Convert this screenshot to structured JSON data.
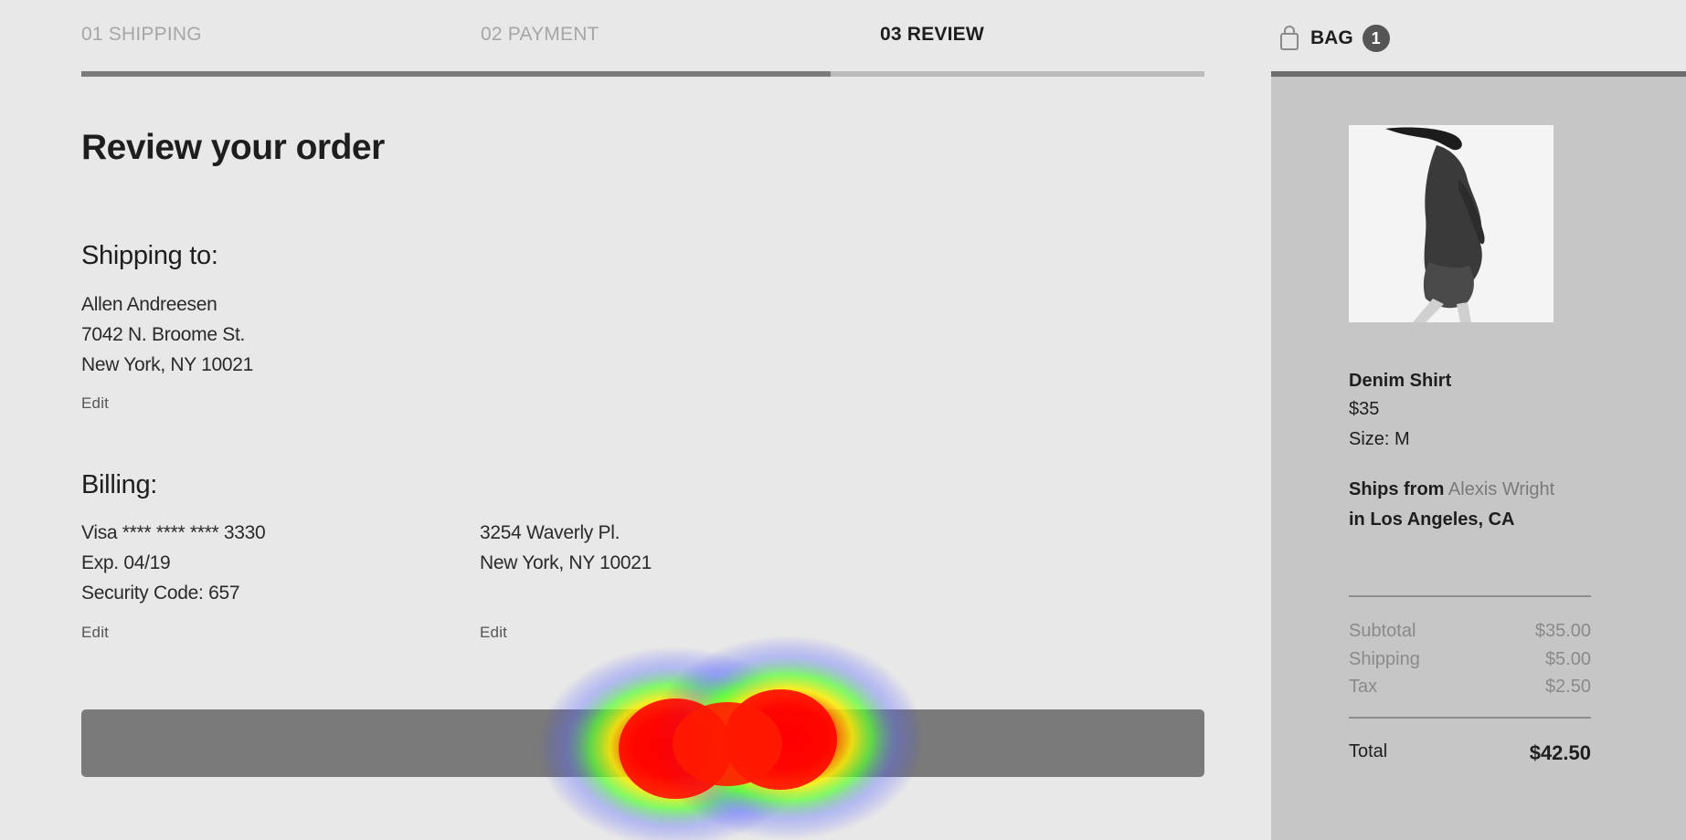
{
  "checkout": {
    "steps": [
      {
        "label": "01 SHIPPING"
      },
      {
        "label": "02 PAYMENT"
      },
      {
        "label": "03 REVIEW"
      }
    ],
    "progress_fraction": 0.667,
    "title": "Review your order",
    "shipping": {
      "heading": "Shipping to:",
      "name": "Allen Andreesen",
      "street": "7042 N. Broome St.",
      "city": "New York, NY 10021",
      "edit_label": "Edit"
    },
    "billing": {
      "heading": "Billing:",
      "card": "Visa **** **** **** 3330",
      "expiry": "Exp. 04/19",
      "security": "Security Code: 657",
      "card_edit_label": "Edit",
      "street": "3254 Waverly Pl.",
      "city": "New York, NY 10021",
      "address_edit_label": "Edit"
    },
    "place_order_label": ""
  },
  "bag": {
    "label": "BAG",
    "count": "1",
    "item": {
      "name": "Denim Shirt",
      "price": "$35",
      "size": "Size: M",
      "ships_prefix": "Ships from",
      "seller": "Alexis Wright",
      "location": "in Los Angeles, CA"
    },
    "summary": {
      "subtotal_label": "Subtotal",
      "subtotal": "$35.00",
      "shipping_label": "Shipping",
      "shipping": "$5.00",
      "tax_label": "Tax",
      "tax": "$2.50",
      "total_label": "Total",
      "total": "$42.50"
    }
  },
  "colors": {
    "background": "#e8e8e8",
    "aside_panel": "#c6c6c6",
    "button": "#7a7a7a",
    "heatmap_hot": "#ff0000"
  }
}
